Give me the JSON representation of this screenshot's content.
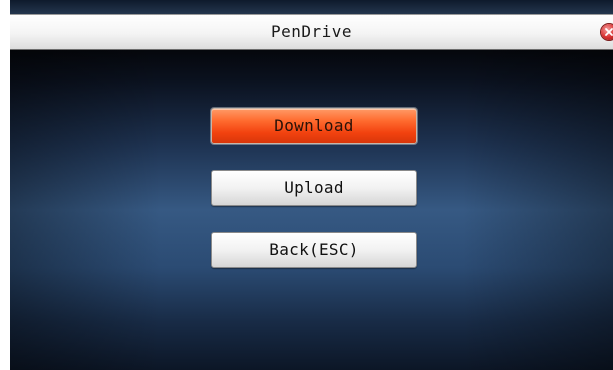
{
  "window": {
    "title": "PenDrive",
    "close_icon": "close-icon",
    "accent_color": "#f2420f"
  },
  "menu": {
    "selected": "Download",
    "items": [
      {
        "label": "Download",
        "state": "selected"
      },
      {
        "label": "Upload",
        "state": "normal"
      },
      {
        "label": "Back(ESC)",
        "state": "normal"
      }
    ]
  }
}
